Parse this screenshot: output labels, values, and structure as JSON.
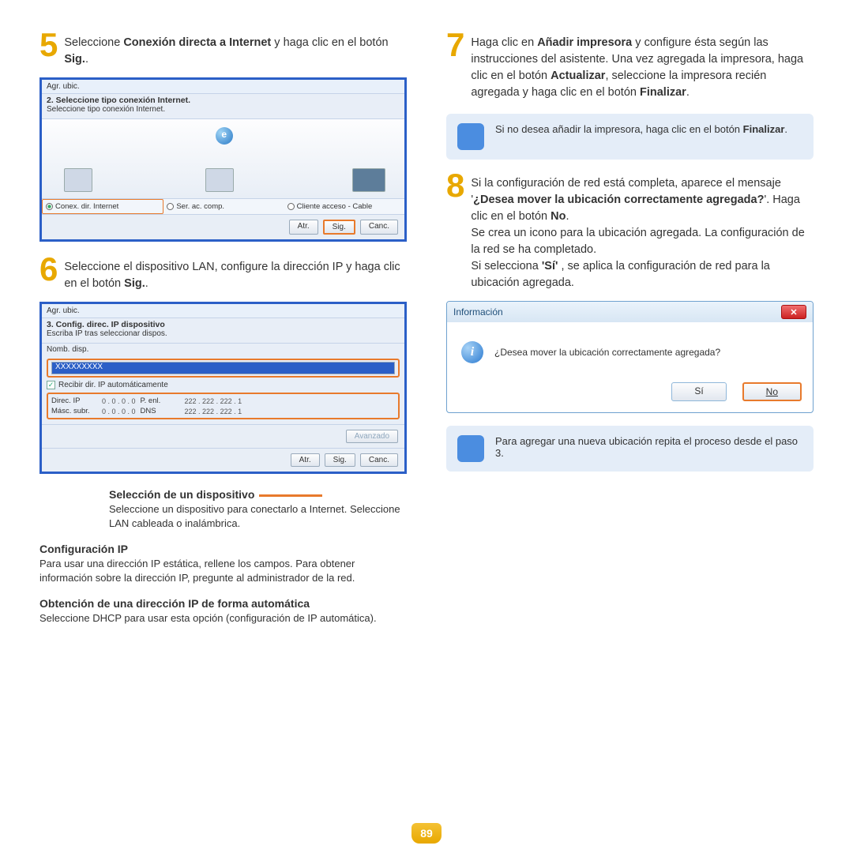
{
  "page_number": "89",
  "left": {
    "step5": {
      "num": "5",
      "text_pre": "Seleccione ",
      "bold1": "Conexión directa a Internet",
      "text_mid": " y haga clic en el botón ",
      "bold2": "Sig.",
      "text_post": "."
    },
    "ss1": {
      "header": "Agr. ubic.",
      "title": "2. Seleccione tipo conexión Internet.",
      "desc": "Seleccione tipo conexión Internet.",
      "opt1": "Conex. dir. Internet",
      "opt2": "Ser. ac. comp.",
      "opt3": "Cliente acceso - Cable",
      "btn_back": "Atr.",
      "btn_next": "Sig.",
      "btn_cancel": "Canc."
    },
    "step6": {
      "num": "6",
      "text_pre": "Seleccione el dispositivo LAN, configure la dirección IP y haga clic en el botón ",
      "bold": "Sig.",
      "text_post": "."
    },
    "ss2": {
      "header": "Agr. ubic.",
      "title": "3. Config. direc. IP dispositivo",
      "desc": "Escriba IP tras seleccionar dispos.",
      "name_label": "Nomb. disp.",
      "name_value": "XXXXXXXXX",
      "auto_chk": "Recibir dir. IP automáticamente",
      "ip_label": "Direc. IP",
      "ip_val": "0 . 0 . 0 . 0",
      "gw_label": "P. enl.",
      "gw_val": "222 . 222 . 222 . 1",
      "mask_label": "Másc. subr.",
      "mask_val": "0 . 0 . 0 . 0",
      "dns_label": "DNS",
      "dns_val": "222 . 222 . 222 . 1",
      "btn_adv": "Avanzado",
      "btn_back": "Atr.",
      "btn_next": "Sig.",
      "btn_cancel": "Canc."
    },
    "callout1": {
      "title": "Selección de un dispositivo",
      "body": "Seleccione un dispositivo para conectarlo a Internet. Seleccione LAN cableada o inalámbrica."
    },
    "callout2": {
      "title": "Configuración IP",
      "body": "Para usar una dirección IP estática, rellene los campos. Para obtener información sobre la dirección IP, pregunte al administrador de la red."
    },
    "callout3": {
      "title": "Obtención de una dirección IP de forma automática",
      "body": "Seleccione DHCP para usar esta opción (configuración de IP automática)."
    }
  },
  "right": {
    "step7": {
      "num": "7",
      "t1": "Haga clic en ",
      "b1": "Añadir impresora",
      "t2": " y configure ésta según las instrucciones del asistente. Una vez agregada la impresora, haga clic en el botón ",
      "b2": "Actualizar",
      "t3": ", seleccione la impresora recién agregada y haga clic en el botón ",
      "b3": "Finalizar",
      "t4": "."
    },
    "note1": {
      "t1": "Si no desea añadir la impresora, haga clic en el botón ",
      "b1": "Finalizar",
      "t2": "."
    },
    "step8": {
      "num": "8",
      "t1": "Si la configuración de red está completa, aparece el mensaje '",
      "b1": "¿Desea mover la ubicación correctamente agregada?",
      "t2": "'. Haga clic en el botón ",
      "b2": "No",
      "t3": ".",
      "t4": "Se crea un icono para la ubicación agregada. La configuración de la red se ha completado.",
      "t5a": "Si selecciona ",
      "b3": "'Sí'",
      "t5b": " , se aplica la configuración de red para la ubicación agregada."
    },
    "dialog": {
      "title": "Información",
      "msg": "¿Desea mover la ubicación correctamente agregada?",
      "yes": "Sí",
      "no": "No"
    },
    "note2": {
      "text": "Para agregar una nueva ubicación repita el proceso desde el paso 3."
    }
  }
}
